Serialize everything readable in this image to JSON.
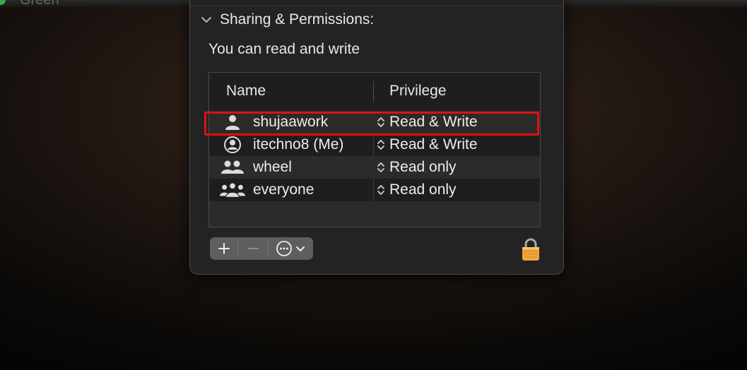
{
  "background": {
    "label": "Green",
    "tag_color": "#2fae4d"
  },
  "sharing": {
    "header": "Sharing & Permissions:",
    "subtitle": "You can read and write",
    "columns": {
      "name": "Name",
      "privilege": "Privilege"
    },
    "rows": [
      {
        "icon": "user-icon",
        "name": "shujaawork",
        "privilege": "Read & Write",
        "highlighted": true
      },
      {
        "icon": "user-circle-icon",
        "name": "itechno8 (Me)",
        "privilege": "Read & Write",
        "highlighted": false
      },
      {
        "icon": "group-icon",
        "name": "wheel",
        "privilege": "Read only",
        "highlighted": false
      },
      {
        "icon": "everyone-icon",
        "name": "everyone",
        "privilege": "Read only",
        "highlighted": false
      }
    ],
    "toolbar": {
      "add_icon": "plus-icon",
      "remove_icon": "minus-icon",
      "more_icon": "ellipsis-circle-icon"
    },
    "lock_icon": "lock-icon",
    "highlight_color": "#e01010"
  }
}
